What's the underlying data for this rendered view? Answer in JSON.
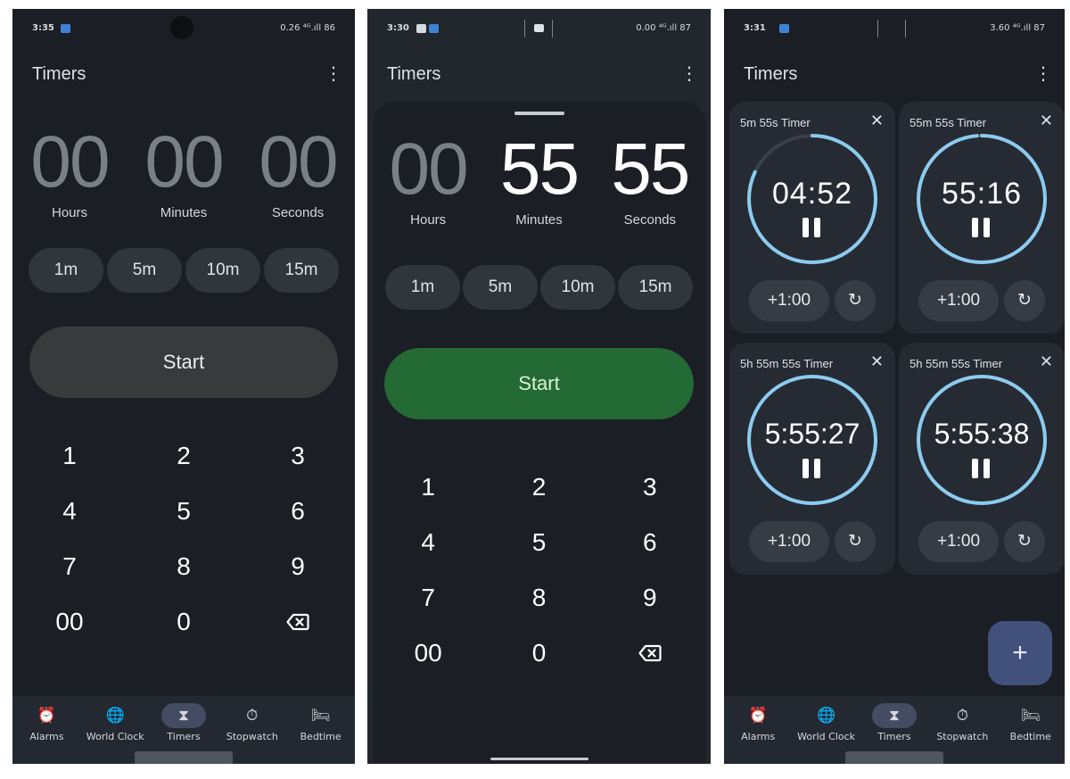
{
  "nav": {
    "items": [
      {
        "icon": "alarm-icon",
        "glyph": "⏰",
        "label": "Alarms"
      },
      {
        "icon": "globe-icon",
        "glyph": "🌐",
        "label": "World Clock"
      },
      {
        "icon": "hourglass-icon",
        "glyph": "⧗",
        "label": "Timers"
      },
      {
        "icon": "stopwatch-icon",
        "glyph": "⏱",
        "label": "Stopwatch"
      },
      {
        "icon": "bed-icon",
        "glyph": "🛏",
        "label": "Bedtime"
      }
    ],
    "active": "Timers"
  },
  "screens": [
    {
      "status": {
        "time": "3:35",
        "right": "0.26 ⁴ᴳ.ıll 86"
      },
      "title": "Timers",
      "menu_glyph": "⋮",
      "digits": [
        {
          "value": "00",
          "label": "Hours"
        },
        {
          "value": "00",
          "label": "Minutes"
        },
        {
          "value": "00",
          "label": "Seconds"
        }
      ],
      "quick": [
        "1m",
        "5m",
        "10m",
        "15m"
      ],
      "start_label": "Start",
      "keys": [
        "1",
        "2",
        "3",
        "4",
        "5",
        "6",
        "7",
        "8",
        "9",
        "00",
        "0"
      ]
    },
    {
      "status": {
        "time": "3:30",
        "right": "0.00 ⁴ᴳ.ıll 87"
      },
      "title": "Timers",
      "menu_glyph": "⋮",
      "digits": [
        {
          "value": "00",
          "label": "Hours"
        },
        {
          "value": "55",
          "label": "Minutes"
        },
        {
          "value": "55",
          "label": "Seconds"
        }
      ],
      "quick": [
        "1m",
        "5m",
        "10m",
        "15m"
      ],
      "start_label": "Start",
      "keys": [
        "1",
        "2",
        "3",
        "4",
        "5",
        "6",
        "7",
        "8",
        "9",
        "00",
        "0"
      ]
    },
    {
      "status": {
        "time": "3:31",
        "right": "3.60 ⁴ᴳ.ıll 87"
      },
      "title": "Timers",
      "menu_glyph": "⋮",
      "timers": [
        {
          "title": "5m 55s Timer",
          "time": "04:52",
          "progress": 0.82
        },
        {
          "title": "55m 55s Timer",
          "time": "55:16",
          "progress": 0.988
        },
        {
          "title": "5h 55m 55s Timer",
          "time": "5:55:27",
          "progress": 0.999
        },
        {
          "title": "5h 55m 55s Timer",
          "time": "5:55:38",
          "progress": 0.9995
        }
      ],
      "add_minute_label": "+1:00",
      "reset_glyph": "↻",
      "close_glyph": "✕",
      "fab_glyph": "+"
    }
  ],
  "colors": {
    "background": "#1b1e24",
    "chip": "#31353c",
    "start_idle": "#393a3b",
    "start_active": "#246a35",
    "ring_active": "#8ccbf0",
    "ring_track": "#3a4048",
    "nav_active": "#434c63",
    "fab": "#42507c"
  }
}
